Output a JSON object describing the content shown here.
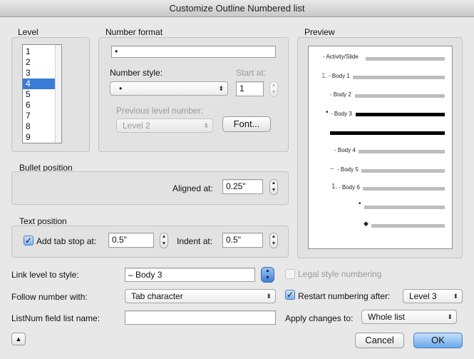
{
  "window": {
    "title": "Customize Outline Numbered list"
  },
  "level": {
    "label": "Level",
    "items": [
      "1",
      "2",
      "3",
      "4",
      "5",
      "6",
      "7",
      "8",
      "9"
    ],
    "selected": "4"
  },
  "number_format": {
    "label": "Number format",
    "format_value": "•",
    "number_style_label": "Number style:",
    "number_style_value": "•",
    "start_at_label": "Start at:",
    "start_at_value": "1",
    "previous_level_label": "Previous level number:",
    "previous_level_value": "Level 2",
    "font_button": "Font..."
  },
  "preview": {
    "label": "Preview",
    "lines": [
      {
        "prefix": "",
        "text": "- Activity/Slide"
      },
      {
        "prefix": "1.",
        "text": "- Body 1"
      },
      {
        "prefix": "",
        "text": "- Body 2"
      },
      {
        "prefix": "•",
        "text": "- Body 3"
      },
      {
        "prefix": "",
        "text": ""
      },
      {
        "prefix": "",
        "text": "- Body 4"
      },
      {
        "prefix": "–",
        "text": "- Body 5"
      },
      {
        "prefix": "1.",
        "text": "- Body 6"
      },
      {
        "prefix": "•",
        "text": ""
      },
      {
        "prefix": "◆",
        "text": ""
      }
    ]
  },
  "bullet_position": {
    "label": "Bullet position",
    "aligned_at_label": "Aligned at:",
    "aligned_at_value": "0.25\""
  },
  "text_position": {
    "label": "Text position",
    "add_tab_stop_label": "Add tab stop at:",
    "add_tab_stop_checked": true,
    "tab_stop_value": "0.5\"",
    "indent_at_label": "Indent at:",
    "indent_at_value": "0.5\""
  },
  "bottom": {
    "link_level_label": "Link level to style:",
    "link_level_value": "– Body 3",
    "legal_style_label": "Legal style numbering",
    "follow_number_label": "Follow number with:",
    "follow_number_value": "Tab character",
    "restart_label": "Restart numbering after:",
    "restart_checked": true,
    "restart_value": "Level 3",
    "listnum_label": "ListNum field list name:",
    "listnum_value": "",
    "apply_changes_label": "Apply changes to:",
    "apply_changes_value": "Whole list"
  },
  "buttons": {
    "cancel": "Cancel",
    "ok": "OK",
    "collapse_icon": "▲"
  },
  "icons": {
    "checkmark": "✓",
    "popup_arrows": "⬍",
    "stepper_up": "▲",
    "stepper_down": "▼"
  }
}
